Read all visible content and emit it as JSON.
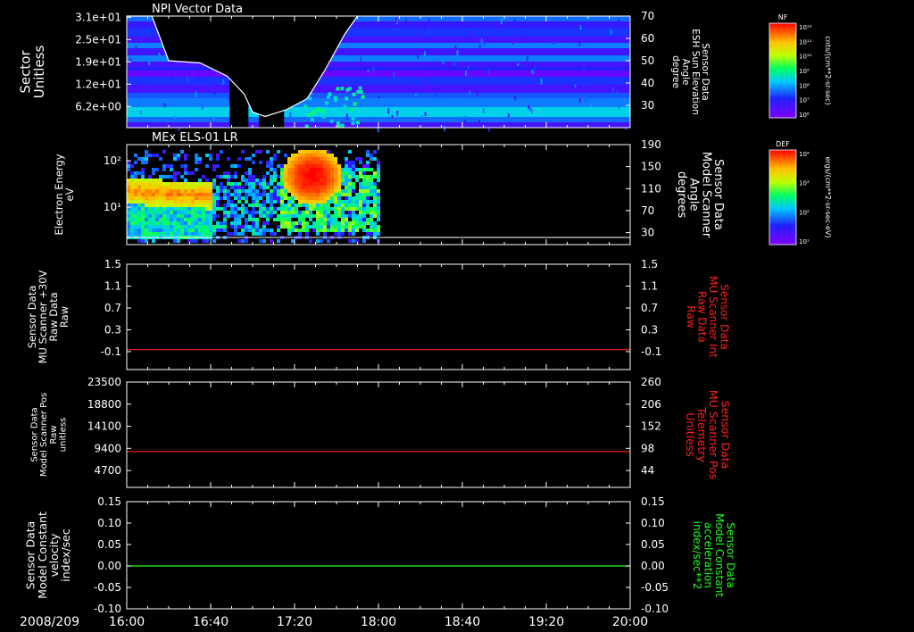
{
  "chart_data": [
    {
      "type": "heatmap",
      "title": "NPI Vector Data",
      "ylabel": "Sector\nUnitless",
      "yticks": [
        "3.1e+01",
        "2.5e+01",
        "1.9e+01",
        "1.2e+01",
        "6.2e+00"
      ],
      "ylabel_right": "Sensor Data\nESH Sun Elevation\nAngle\ndegree",
      "yticks_right": [
        "70",
        "60",
        "50",
        "40",
        "30"
      ],
      "ylim_right": [
        20,
        70
      ],
      "colorbar_label": "NF",
      "colorbar_unit": "cnts/(cm**2-sr-sec)",
      "colorbar_ticks": [
        "10¹²",
        "10¹¹",
        "10¹⁰",
        "10⁹",
        "10⁸",
        "10⁷",
        "10⁶"
      ],
      "overlay_series": {
        "color": "#ffffff",
        "points": [
          [
            "16:00",
            70
          ],
          [
            "16:12",
            70
          ],
          [
            "16:20",
            50
          ],
          [
            "16:35",
            49
          ],
          [
            "16:48",
            43
          ],
          [
            "16:56",
            35
          ],
          [
            "17:00",
            27
          ],
          [
            "17:06",
            25
          ],
          [
            "17:16",
            28
          ],
          [
            "17:26",
            33
          ],
          [
            "17:34",
            45
          ],
          [
            "17:44",
            62
          ],
          [
            "17:50",
            70
          ]
        ]
      },
      "data_gaps": [
        [
          "16:49",
          "16:58"
        ],
        [
          "17:03",
          "17:15"
        ]
      ]
    },
    {
      "type": "heatmap",
      "title": "MEx ELS-01 LR",
      "ylabel": "Electron Energy\neV",
      "yticks": [
        "10²",
        "10¹"
      ],
      "ylabel_right": "Sensor Data\nModel Scanner\nAngle\ndegrees",
      "yticks_right": [
        "190",
        "150",
        "110",
        "70",
        "30"
      ],
      "colorbar_label": "DEF",
      "colorbar_unit": "ergs/(cm**2-sr-sec-eV)",
      "colorbar_ticks": [
        "10⁴",
        "10³",
        "10²",
        "10¹"
      ],
      "data_until": "18:00",
      "overlay_series": {
        "color": "#ffffff",
        "value": 10
      }
    },
    {
      "type": "line",
      "ylabel": "Sensor Data\nMU Scanner +30V\nRaw Data\nRaw",
      "yticks": [
        "1.5",
        "1.1",
        "0.7",
        "0.3",
        "-0.1"
      ],
      "ylim": [
        -0.35,
        1.5
      ],
      "ylabel_right": "Sensor Data\nMU Scanner Int\nRaw Data\nRaw",
      "yticks_right": [
        "1.5",
        "1.1",
        "0.7",
        "0.3",
        "-0.1"
      ],
      "series": [
        {
          "color": "#ff2020",
          "values": [
            0.0,
            0.0
          ]
        }
      ]
    },
    {
      "type": "line",
      "ylabel": "Sensor Data\nModel Scanner Pos\nRaw\nunitless",
      "yticks": [
        "23500",
        "18800",
        "14100",
        "9400",
        "4700"
      ],
      "ylim": [
        0,
        23500
      ],
      "ylabel_right": "Sensor Data\nMU Scanner Pos\nTelemetry\nUnitless",
      "yticks_right": [
        "260",
        "206",
        "152",
        "98",
        "44"
      ],
      "series": [
        {
          "color": "#ff2020",
          "values": [
            8000,
            8000
          ]
        }
      ]
    },
    {
      "type": "line",
      "ylabel": "Sensor Data\nModel Constant\nvelocity\nindex/sec",
      "yticks": [
        "0.15",
        "0.10",
        "0.05",
        "0.00",
        "-0.05",
        "-0.10"
      ],
      "ylim": [
        -0.1,
        0.15
      ],
      "ylabel_right": "Sensor Data\nModel Constant\nacceleration\nindex/sec**2",
      "yticks_right": [
        "0.15",
        "0.10",
        "0.05",
        "0.00",
        "-0.05",
        "-0.10"
      ],
      "series": [
        {
          "color": "#20ff20",
          "values": [
            0.0,
            0.0
          ]
        }
      ]
    }
  ],
  "time_axis": {
    "date": "2008/209",
    "ticks": [
      "16:00",
      "16:40",
      "17:20",
      "18:00",
      "18:40",
      "19:20",
      "20:00"
    ],
    "range": [
      "16:00",
      "20:00"
    ]
  },
  "colors": {
    "right_label_panel3": "#ff2020",
    "right_label_panel4": "#ff2020",
    "right_label_panel5": "#20ff20"
  }
}
